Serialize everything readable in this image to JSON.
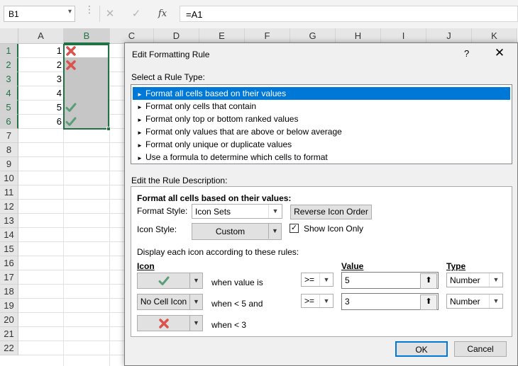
{
  "formula_bar": {
    "name_box": "B1",
    "name_arrow": "▾",
    "cancel_icon": "✕",
    "enter_icon": "✓",
    "fx_label": "fx",
    "formula": "=A1"
  },
  "grid": {
    "columns": [
      "A",
      "B",
      "C",
      "D",
      "E",
      "F",
      "G",
      "H",
      "I",
      "J",
      "K"
    ],
    "rows": [
      "1",
      "2",
      "3",
      "4",
      "5",
      "6",
      "7",
      "8",
      "9",
      "10",
      "11",
      "12",
      "13",
      "14",
      "15",
      "16",
      "17",
      "18",
      "19",
      "20",
      "21",
      "22"
    ],
    "colA_values": [
      "1",
      "2",
      "3",
      "4",
      "5",
      "6"
    ],
    "cell_icons": [
      "red-x-icon",
      "red-x-icon",
      "",
      "",
      "green-check-icon",
      "green-check-icon"
    ]
  },
  "dialog": {
    "title": "Edit Formatting Rule",
    "help": "?",
    "close": "✕",
    "select_rule_label": "Select a Rule Type:",
    "rule_types": [
      "Format all cells based on their values",
      "Format only cells that contain",
      "Format only top or bottom ranked values",
      "Format only values that are above or below average",
      "Format only unique or duplicate values",
      "Use a formula to determine which cells to format"
    ],
    "selected_rule_index": 0,
    "rule_arrow": "►",
    "edit_desc_label": "Edit the Rule Description:",
    "desc_heading": "Format all cells based on their values:",
    "format_style_label": "Format Style:",
    "format_style_value": "Icon Sets",
    "reverse_button": "Reverse Icon Order",
    "icon_style_label": "Icon Style:",
    "icon_style_value": "Custom",
    "show_icon_only_label": "Show Icon Only",
    "show_icon_only_checked": "✓",
    "display_rules_label": "Display each icon according to these rules:",
    "icon_col": "Icon",
    "value_col": "Value",
    "type_col": "Type",
    "rules": [
      {
        "icon": "green-check-icon",
        "icon_text": "",
        "condition": "when value is",
        "operator": ">=",
        "value": "5",
        "type": "Number"
      },
      {
        "icon": "no-cell-icon",
        "icon_text": "No Cell Icon",
        "condition": "when < 5 and",
        "operator": ">=",
        "value": "3",
        "type": "Number"
      },
      {
        "icon": "red-x-icon",
        "icon_text": "",
        "condition": "when < 3"
      }
    ],
    "ok": "OK",
    "cancel": "Cancel",
    "colors": {
      "selection": "#0078d7",
      "excel_green": "#217346",
      "icon_green": "#5a9e77",
      "icon_red": "#d9534f"
    }
  }
}
